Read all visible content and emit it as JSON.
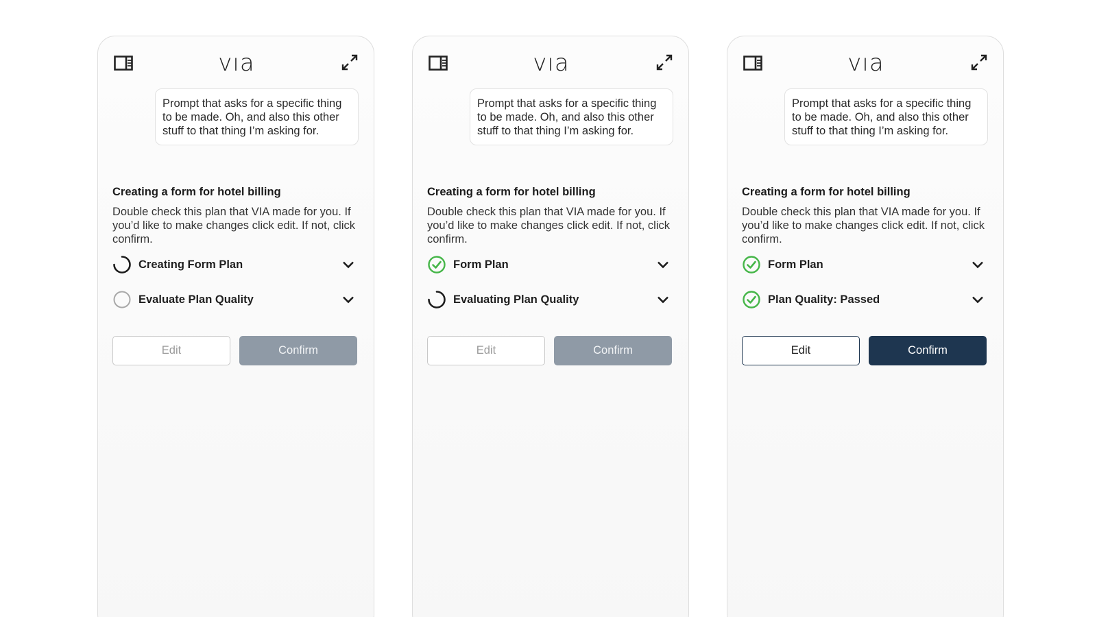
{
  "brand": {
    "logo_text": "vıa"
  },
  "colors": {
    "accent_dark": "#1e3650",
    "success_green": "#46b649",
    "disabled_gray": "#8f9aa6"
  },
  "panels": [
    {
      "prompt": "Prompt that asks for a specific thing to be made. Oh, and also this other stuff to that thing I’m asking for.",
      "plan_title": "Creating a form for hotel billing",
      "plan_description": "Double check this plan that VIA made for you. If you’d like to make changes click edit. If not, click confirm.",
      "steps": [
        {
          "label": "Creating Form Plan",
          "status": "in-progress",
          "status_icon": "spinner-icon"
        },
        {
          "label": "Evaluate Plan Quality",
          "status": "pending",
          "status_icon": "empty-circle-icon"
        }
      ],
      "edit_label": "Edit",
      "confirm_label": "Confirm",
      "buttons_enabled": false
    },
    {
      "prompt": "Prompt that asks for a specific thing to be made. Oh, and also this other stuff to that thing I’m asking for.",
      "plan_title": "Creating a form for hotel billing",
      "plan_description": "Double check this plan that VIA made for you. If you’d like to make changes click edit. If not, click confirm.",
      "steps": [
        {
          "label": "Form Plan",
          "status": "complete",
          "status_icon": "check-circle-icon"
        },
        {
          "label": "Evaluating Plan Quality",
          "status": "in-progress",
          "status_icon": "spinner-icon"
        }
      ],
      "edit_label": "Edit",
      "confirm_label": "Confirm",
      "buttons_enabled": false
    },
    {
      "prompt": "Prompt that asks for a specific thing to be made. Oh, and also this other stuff to that thing I’m asking for.",
      "plan_title": "Creating a form for hotel billing",
      "plan_description": "Double check this plan that VIA made for you. If you’d like to make changes click edit. If not, click confirm.",
      "steps": [
        {
          "label": "Form Plan",
          "status": "complete",
          "status_icon": "check-circle-icon"
        },
        {
          "label": "Plan Quality: Passed",
          "status": "complete",
          "status_icon": "check-circle-icon"
        }
      ],
      "edit_label": "Edit",
      "confirm_label": "Confirm",
      "buttons_enabled": true
    }
  ]
}
